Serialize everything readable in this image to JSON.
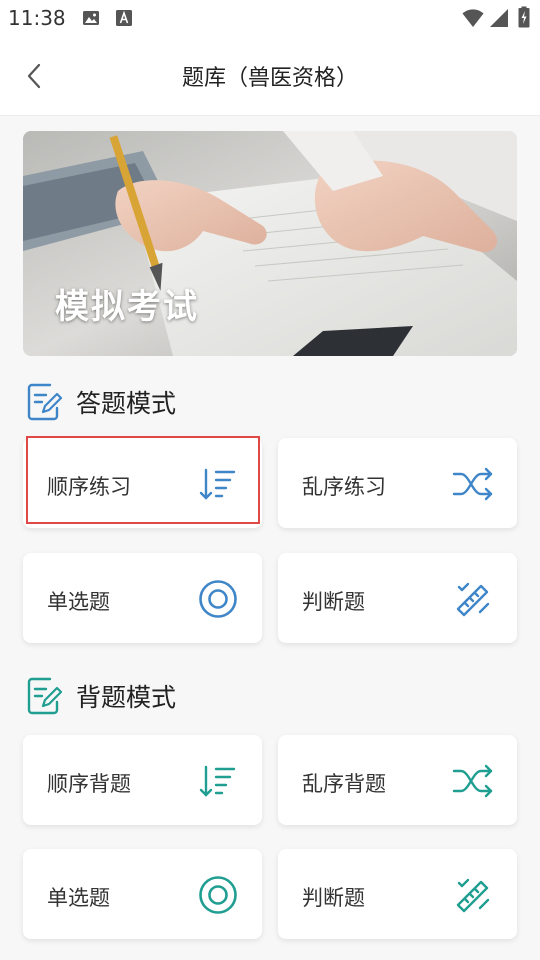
{
  "status_bar": {
    "time": "11:38"
  },
  "header": {
    "title": "题库（兽医资格）"
  },
  "banner": {
    "title": "模拟考试"
  },
  "sections": [
    {
      "title": "答题模式",
      "color": "#3f86c9",
      "cards": [
        {
          "label": "顺序练习",
          "icon": "sort-list-icon"
        },
        {
          "label": "乱序练习",
          "icon": "shuffle-icon"
        },
        {
          "label": "单选题",
          "icon": "target-circle-icon"
        },
        {
          "label": "判断题",
          "icon": "ruler-check-icon"
        }
      ]
    },
    {
      "title": "背题模式",
      "color": "#1f9e91",
      "cards": [
        {
          "label": "顺序背题",
          "icon": "sort-list-icon"
        },
        {
          "label": "乱序背题",
          "icon": "shuffle-icon"
        },
        {
          "label": "单选题",
          "icon": "target-circle-icon"
        },
        {
          "label": "判断题",
          "icon": "ruler-check-icon"
        }
      ]
    }
  ]
}
